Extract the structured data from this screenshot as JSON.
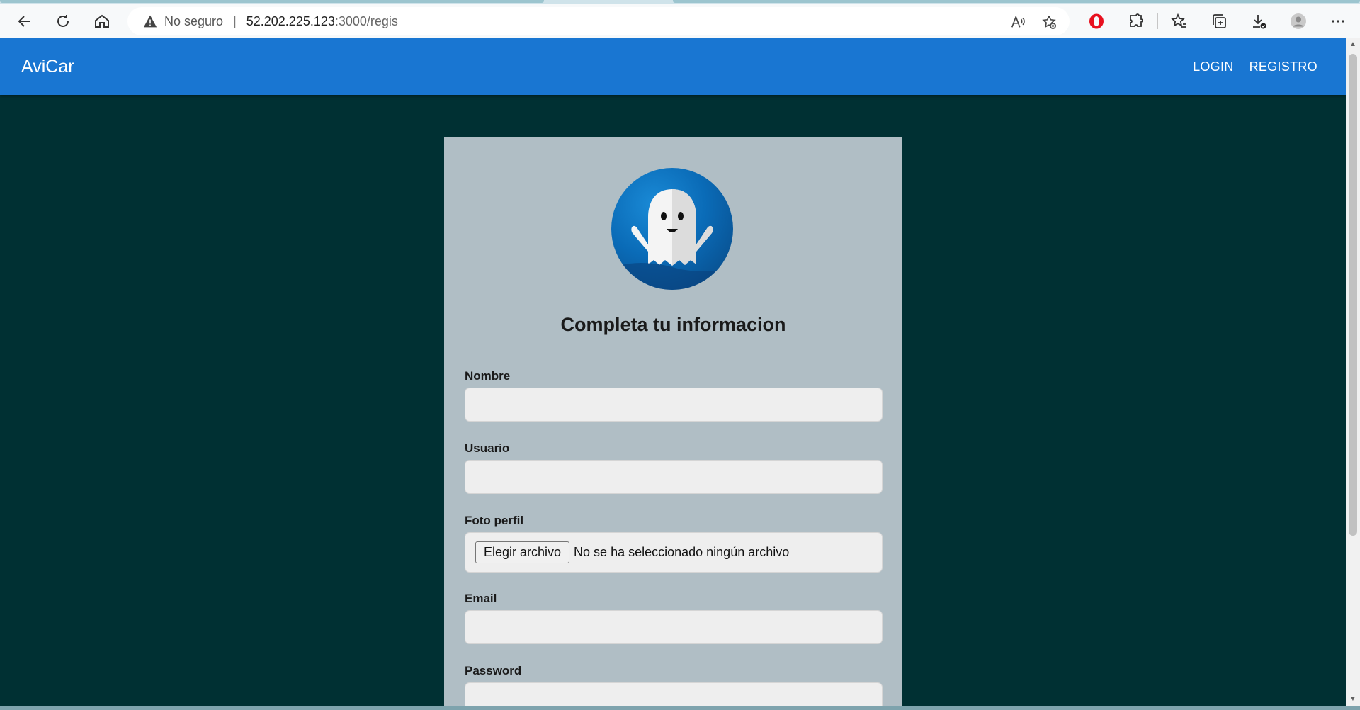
{
  "browser": {
    "security_label": "No seguro",
    "url_host": "52.202.225.123",
    "url_path": ":3000/regis"
  },
  "navbar": {
    "brand": "AviCar",
    "links": [
      "LOGIN",
      "REGISTRO"
    ]
  },
  "form": {
    "title": "Completa tu informacion",
    "fields": {
      "nombre": {
        "label": "Nombre",
        "value": ""
      },
      "usuario": {
        "label": "Usuario",
        "value": ""
      },
      "foto": {
        "label": "Foto perfil",
        "button": "Elegir archivo",
        "status": "No se ha seleccionado ningún archivo"
      },
      "email": {
        "label": "Email",
        "value": ""
      },
      "password": {
        "label": "Password",
        "value": ""
      }
    }
  },
  "colors": {
    "navbar": "#1976d2",
    "page_background": "#003033",
    "card": "#b0bec5",
    "input": "#eeeeee"
  },
  "icons": [
    "back-icon",
    "refresh-icon",
    "home-icon",
    "warning-icon",
    "read-aloud-icon",
    "add-favorite-icon",
    "opera-icon",
    "extensions-icon",
    "favorites-icon",
    "collections-icon",
    "downloads-icon",
    "profile-icon",
    "more-icon",
    "ghost-avatar"
  ]
}
